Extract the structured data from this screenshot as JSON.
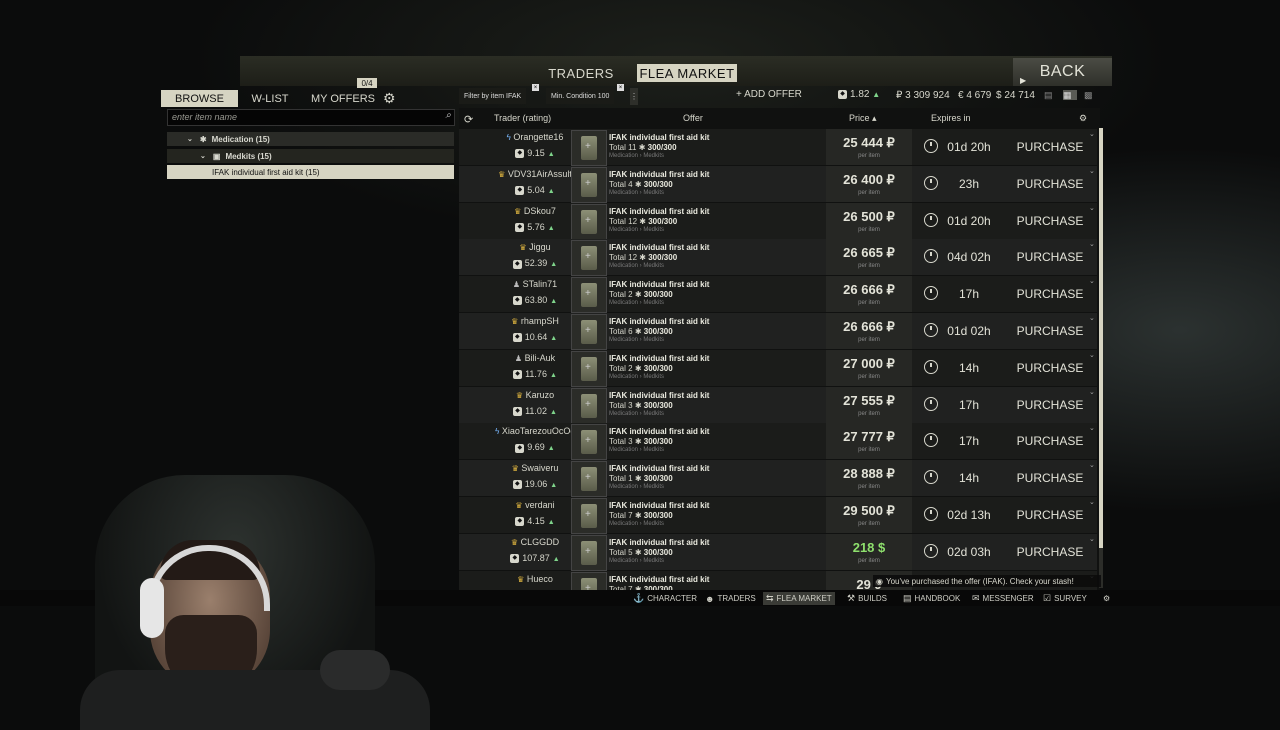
{
  "tabs": {
    "traders": "TRADERS",
    "flea_market": "FLEA MARKET",
    "back": "BACK"
  },
  "left_menu": {
    "browse": "BROWSE",
    "wlist": "W-LIST",
    "my_offers": "MY OFFERS",
    "offers_count": "0/4",
    "search_placeholder": "enter item name",
    "categories": [
      {
        "label": "Medication (15)"
      },
      {
        "label": "Medkits (15)"
      },
      {
        "label": "IFAK individual first aid kit (15)"
      }
    ]
  },
  "filters": {
    "by_item": "Filter by item IFAK",
    "min_condition": "Min. Condition 100",
    "add_offer": "+ ADD OFFER"
  },
  "player": {
    "rating": "1.82",
    "roubles": "₽ 3 309 924",
    "euros": "€ 4 679",
    "dollars": "$ 24 714"
  },
  "table_headers": {
    "trader": "Trader (rating)",
    "offer": "Offer",
    "price": "Price ▴",
    "expires": "Expires in"
  },
  "offers": [
    {
      "trader": "Orangette16",
      "rep": "9.15",
      "badge": "blue",
      "total": "11",
      "condition": "300/300",
      "price": "25 444 ₽",
      "expires": "01d 20h"
    },
    {
      "trader": "VDV31AirAssult",
      "rep": "5.04",
      "badge": "crown",
      "total": "4",
      "condition": "300/300",
      "price": "26 400 ₽",
      "expires": "23h"
    },
    {
      "trader": "DSkou7",
      "rep": "5.76",
      "badge": "crown",
      "total": "12",
      "condition": "300/300",
      "price": "26 500 ₽",
      "expires": "01d 20h"
    },
    {
      "trader": "Jiggu",
      "rep": "52.39",
      "badge": "crown",
      "total": "12",
      "condition": "300/300",
      "price": "26 665 ₽",
      "expires": "04d 02h"
    },
    {
      "trader": "STalin71",
      "rep": "63.80",
      "badge": "person",
      "total": "2",
      "condition": "300/300",
      "price": "26 666 ₽",
      "expires": "17h"
    },
    {
      "trader": "rhampSH",
      "rep": "10.64",
      "badge": "crown",
      "total": "6",
      "condition": "300/300",
      "price": "26 666 ₽",
      "expires": "01d 02h"
    },
    {
      "trader": "Bili-Auk",
      "rep": "11.76",
      "badge": "person",
      "total": "2",
      "condition": "300/300",
      "price": "27 000 ₽",
      "expires": "14h"
    },
    {
      "trader": "Karuzo",
      "rep": "11.02",
      "badge": "crown",
      "total": "3",
      "condition": "300/300",
      "price": "27 555 ₽",
      "expires": "17h"
    },
    {
      "trader": "XiaoTarezouOcOc",
      "rep": "9.69",
      "badge": "blue",
      "total": "3",
      "condition": "300/300",
      "price": "27 777 ₽",
      "expires": "17h"
    },
    {
      "trader": "Swaiveru",
      "rep": "19.06",
      "badge": "crown",
      "total": "1",
      "condition": "300/300",
      "price": "28 888 ₽",
      "expires": "14h"
    },
    {
      "trader": "verdani",
      "rep": "4.15",
      "badge": "crown",
      "total": "7",
      "condition": "300/300",
      "price": "29 500 ₽",
      "expires": "02d 13h"
    },
    {
      "trader": "CLGGDD",
      "rep": "107.87",
      "badge": "crown",
      "total": "5",
      "condition": "300/300",
      "price": "218 $",
      "expires": "02d 03h",
      "usd": true
    },
    {
      "trader": "Hueco",
      "rep": "",
      "badge": "crown",
      "total": "7",
      "condition": "300/300",
      "price": "29 9",
      "expires": ""
    }
  ],
  "row_common": {
    "item_name": "IFAK individual first aid kit",
    "total_label": "Total",
    "path": "Medication › Medkits",
    "per_item": "per item",
    "purchase": "PURCHASE"
  },
  "toast": "You've purchased the offer (IFAK). Check your stash!",
  "bottom_nav": {
    "character": "CHARACTER",
    "traders": "TRADERS",
    "flea_market": "FLEA MARKET",
    "builds": "BUILDS",
    "handbook": "HANDBOOK",
    "messenger": "MESSENGER",
    "survey": "SURVEY"
  },
  "colors": {
    "accent": "#d6d4c2",
    "usd_green": "#8ee06d",
    "rep_up": "#7fd48b"
  }
}
